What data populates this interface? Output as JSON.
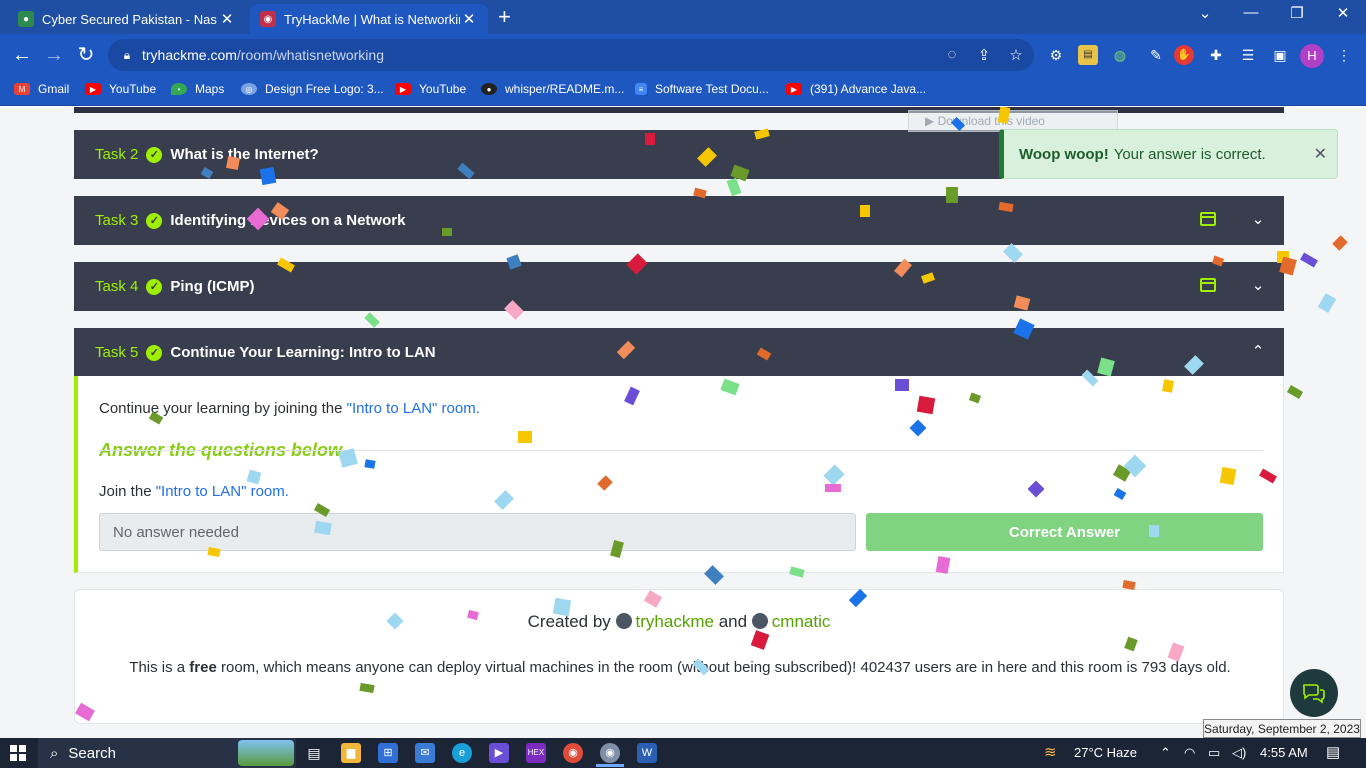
{
  "browser": {
    "tabs": [
      {
        "title": "Cyber Secured Pakistan - Nas.io",
        "close": "✕"
      },
      {
        "title": "TryHackMe | What is Networking",
        "close": "✕"
      }
    ],
    "new_tab": "+",
    "url": {
      "domain": "tryhackme.com",
      "path": "/room/whatisnetworking"
    },
    "profile_initial": "H",
    "bookmarks": [
      {
        "label": "Gmail",
        "icon": "gmail-icon",
        "color": "#ea4335"
      },
      {
        "label": "YouTube",
        "icon": "youtube-icon",
        "color": "#ff0000"
      },
      {
        "label": "Maps",
        "icon": "maps-icon",
        "color": "#34a853"
      },
      {
        "label": "Design Free Logo: 3...",
        "icon": "design-logo-icon",
        "color": "#7aa3e6"
      },
      {
        "label": "YouTube",
        "icon": "youtube-icon",
        "color": "#ff0000"
      },
      {
        "label": "whisper/README.m...",
        "icon": "github-icon",
        "color": "#222222"
      },
      {
        "label": "Software Test Docu...",
        "icon": "docs-icon",
        "color": "#4285f4"
      },
      {
        "label": "(391) Advance Java...",
        "icon": "youtube-icon",
        "color": "#ff0000"
      }
    ]
  },
  "tasks": [
    {
      "number": "Task 2",
      "title": "What is the Internet?"
    },
    {
      "number": "Task 3",
      "title": "Identifying Devices on a Network"
    },
    {
      "number": "Task 4",
      "title": "Ping (ICMP)"
    },
    {
      "number": "Task 5",
      "title": "Continue Your Learning: Intro to LAN"
    }
  ],
  "task5": {
    "intro_prefix": "Continue your learning by joining the ",
    "intro_link": "\"Intro to LAN\" room.",
    "answer_heading": "Answer the questions below",
    "question_prefix": "Join the ",
    "question_link": "\"Intro to LAN\" room.",
    "answer_placeholder": "No answer needed",
    "correct_button": "Correct Answer"
  },
  "footer": {
    "created_by": "Created by",
    "author1": "tryhackme",
    "and": "and",
    "author2": "cmnatic",
    "free_prefix": "This is a ",
    "free_bold": "free",
    "free_rest": " room, which means anyone can deploy virtual machines in the room (without being subscribed)! 402437 users are in here and this room is 793 days old."
  },
  "toast": {
    "bold": "Woop woop!",
    "text": "Your answer is correct.",
    "close": "✕"
  },
  "video_overlay": "▶ Download this video",
  "taskbar": {
    "search": "Search",
    "weather": "27°C  Haze",
    "time": "4:55 AM",
    "date_tooltip": "Saturday, September 2, 2023"
  }
}
